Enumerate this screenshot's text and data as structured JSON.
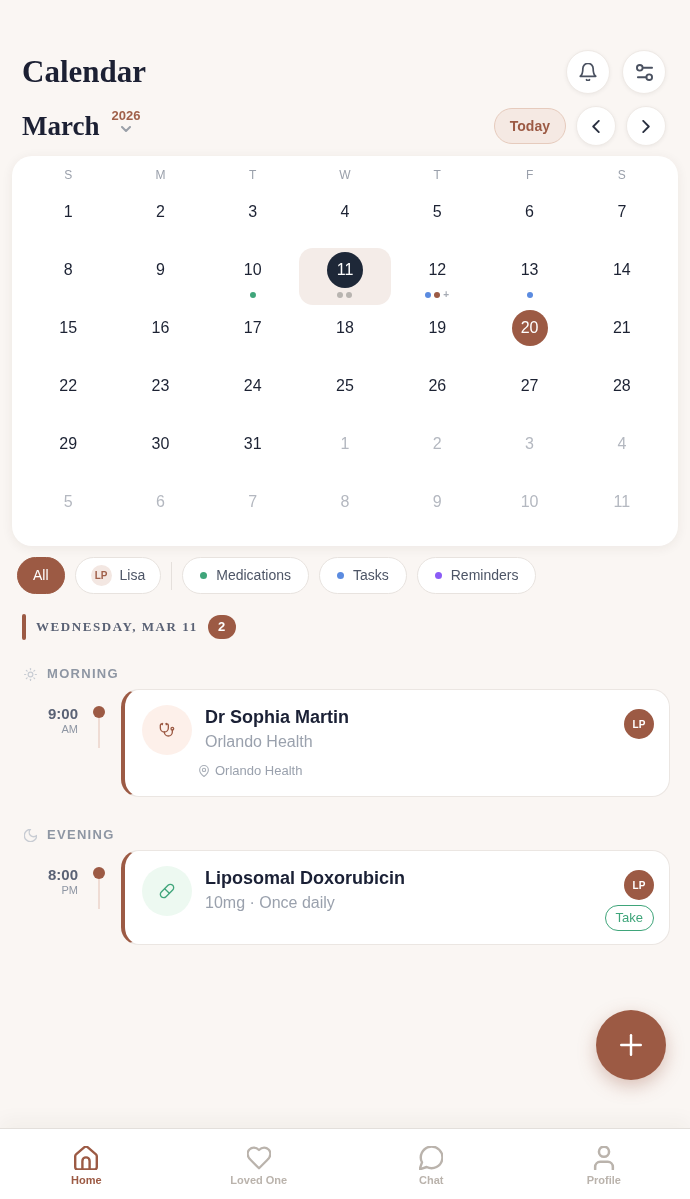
{
  "header": {
    "title": "Calendar",
    "month": "March",
    "year": "2026",
    "today_button": "Today"
  },
  "calendar": {
    "weekdays": [
      "S",
      "M",
      "T",
      "W",
      "T",
      "F",
      "S"
    ],
    "weeks": [
      [
        {
          "label": "1",
          "in_month": true,
          "selected": false,
          "today": false
        },
        {
          "label": "2",
          "in_month": true,
          "selected": false,
          "today": false
        },
        {
          "label": "3",
          "in_month": true,
          "selected": false,
          "today": false
        },
        {
          "label": "4",
          "in_month": true,
          "selected": false,
          "today": false
        },
        {
          "label": "5",
          "in_month": true,
          "selected": false,
          "today": false
        },
        {
          "label": "6",
          "in_month": true,
          "selected": false,
          "today": false
        },
        {
          "label": "7",
          "in_month": true,
          "selected": false,
          "today": false
        }
      ],
      [
        {
          "label": "8",
          "in_month": true,
          "selected": false,
          "today": false
        },
        {
          "label": "9",
          "in_month": true,
          "selected": false,
          "today": false
        },
        {
          "label": "10",
          "in_month": true,
          "selected": false,
          "today": false,
          "dots": [
            {
              "color": "#3fa57a"
            }
          ]
        },
        {
          "label": "11",
          "in_month": true,
          "selected": true,
          "today": false,
          "dots": [
            {
              "color": "#b8b4b0"
            },
            {
              "color": "#b8b4b0"
            }
          ]
        },
        {
          "label": "12",
          "in_month": true,
          "selected": false,
          "today": false,
          "dots": [
            {
              "color": "#5b8be0"
            },
            {
              "color": "#9c5a44"
            }
          ],
          "more": "+"
        },
        {
          "label": "13",
          "in_month": true,
          "selected": false,
          "today": false,
          "dots": [
            {
              "color": "#5b8be0"
            }
          ]
        },
        {
          "label": "14",
          "in_month": true,
          "selected": false,
          "today": false
        }
      ],
      [
        {
          "label": "15",
          "in_month": true,
          "selected": false,
          "today": false
        },
        {
          "label": "16",
          "in_month": true,
          "selected": false,
          "today": false
        },
        {
          "label": "17",
          "in_month": true,
          "selected": false,
          "today": false
        },
        {
          "label": "18",
          "in_month": true,
          "selected": false,
          "today": false
        },
        {
          "label": "19",
          "in_month": true,
          "selected": false,
          "today": false
        },
        {
          "label": "20",
          "in_month": true,
          "selected": false,
          "today": true
        },
        {
          "label": "21",
          "in_month": true,
          "selected": false,
          "today": false
        }
      ],
      [
        {
          "label": "22",
          "in_month": true,
          "selected": false,
          "today": false
        },
        {
          "label": "23",
          "in_month": true,
          "selected": false,
          "today": false
        },
        {
          "label": "24",
          "in_month": true,
          "selected": false,
          "today": false
        },
        {
          "label": "25",
          "in_month": true,
          "selected": false,
          "today": false
        },
        {
          "label": "26",
          "in_month": true,
          "selected": false,
          "today": false
        },
        {
          "label": "27",
          "in_month": true,
          "selected": false,
          "today": false
        },
        {
          "label": "28",
          "in_month": true,
          "selected": false,
          "today": false
        }
      ],
      [
        {
          "label": "29",
          "in_month": true,
          "selected": false,
          "today": false
        },
        {
          "label": "30",
          "in_month": true,
          "selected": false,
          "today": false
        },
        {
          "label": "31",
          "in_month": true,
          "selected": false,
          "today": false
        },
        {
          "label": "1",
          "in_month": false,
          "selected": false,
          "today": false
        },
        {
          "label": "2",
          "in_month": false,
          "selected": false,
          "today": false
        },
        {
          "label": "3",
          "in_month": false,
          "selected": false,
          "today": false
        },
        {
          "label": "4",
          "in_month": false,
          "selected": false,
          "today": false
        }
      ],
      [
        {
          "label": "5",
          "in_month": false,
          "selected": false,
          "today": false
        },
        {
          "label": "6",
          "in_month": false,
          "selected": false,
          "today": false
        },
        {
          "label": "7",
          "in_month": false,
          "selected": false,
          "today": false
        },
        {
          "label": "8",
          "in_month": false,
          "selected": false,
          "today": false
        },
        {
          "label": "9",
          "in_month": false,
          "selected": false,
          "today": false
        },
        {
          "label": "10",
          "in_month": false,
          "selected": false,
          "today": false
        },
        {
          "label": "11",
          "in_month": false,
          "selected": false,
          "today": false
        }
      ]
    ]
  },
  "filters": [
    {
      "kind": "all",
      "label": "All",
      "selected": true
    },
    {
      "kind": "person",
      "label": "Lisa",
      "initials": "LP",
      "selected": false
    },
    {
      "kind": "category",
      "label": "Medications",
      "color": "#3fa57a",
      "selected": false
    },
    {
      "kind": "category",
      "label": "Tasks",
      "color": "#5b8be0",
      "selected": false
    },
    {
      "kind": "category",
      "label": "Reminders",
      "color": "#8b5cf6",
      "selected": false
    }
  ],
  "day_heading": {
    "label": "WEDNESDAY, MAR 11",
    "count": "2"
  },
  "sections": [
    {
      "kind": "morning",
      "label": "MORNING",
      "events": [
        {
          "kind": "appointment",
          "time": "9:00",
          "period": "AM",
          "title": "Dr Sophia Martin",
          "subtitle": "Orlando Health",
          "location": "Orlando Health",
          "assignee": "LP"
        }
      ]
    },
    {
      "kind": "evening",
      "label": "EVENING",
      "events": [
        {
          "kind": "medication",
          "time": "8:00",
          "period": "PM",
          "title": "Liposomal Doxorubicin",
          "subtitle": "10mg · Once daily",
          "assignee": "LP",
          "action": "Take"
        }
      ]
    }
  ],
  "nav": [
    {
      "kind": "home",
      "label": "Home",
      "selected": true
    },
    {
      "kind": "heart",
      "label": "Loved One",
      "selected": false
    },
    {
      "kind": "chat",
      "label": "Chat",
      "selected": false
    },
    {
      "kind": "profile",
      "label": "Profile",
      "selected": false
    }
  ]
}
